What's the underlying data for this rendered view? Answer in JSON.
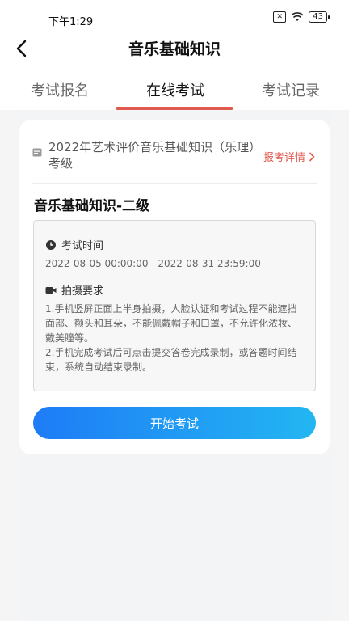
{
  "status_bar": {
    "time": "下午1:29",
    "battery": "43"
  },
  "nav": {
    "title": "音乐基础知识"
  },
  "tabs": [
    {
      "label": "考试报名",
      "active": false
    },
    {
      "label": "在线考试",
      "active": true
    },
    {
      "label": "考试记录",
      "active": false
    }
  ],
  "card": {
    "exam_name": "2022年艺术评价音乐基础知识（乐理）考级",
    "detail_link": "报考详情",
    "level_title": "音乐基础知识-二级",
    "exam_time_label": "考试时间",
    "exam_time_value": "2022-08-05 00:00:00 - 2022-08-31 23:59:00",
    "shoot_req_label": "拍摄要求",
    "shoot_req_line1": "1.手机竖屏正面上半身拍摄，人脸认证和考试过程不能遮挡面部、额头和耳朵，不能佩戴帽子和口罩，不允许化浓妆、戴美瞳等。",
    "shoot_req_line2": "2.手机完成考试后可点击提交答卷完成录制，或答题时间结束，系统自动结束录制。",
    "start_button": "开始考试"
  },
  "colors": {
    "accent_red": "#e0594f",
    "button_start": "#1e7cf6",
    "button_end": "#23b6f2"
  }
}
